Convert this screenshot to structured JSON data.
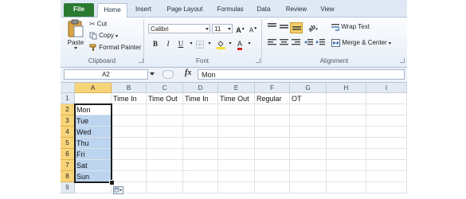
{
  "tabs": [
    "File",
    "Home",
    "Insert",
    "Page Layout",
    "Formulas",
    "Data",
    "Review",
    "View"
  ],
  "clipboard": {
    "paste": "Paste",
    "cut": "Cut",
    "copy": "Copy",
    "format_painter": "Format Painter",
    "group": "Clipboard"
  },
  "font": {
    "name": "Calibri",
    "size": "11",
    "bold": "B",
    "italic": "I",
    "underline": "U",
    "grow": "A",
    "shrink": "A",
    "color_letter": "A",
    "group": "Font"
  },
  "alignment": {
    "wrap_text": "Wrap Text",
    "merge_center": "Merge & Center",
    "group": "Alignment"
  },
  "formula_bar": {
    "name_box": "A2",
    "fx": "fx",
    "content": "Mon"
  },
  "columns": [
    "A",
    "B",
    "C",
    "D",
    "E",
    "F",
    "G",
    "H",
    "I"
  ],
  "rows": [
    "1",
    "2",
    "3",
    "4",
    "5",
    "6",
    "7",
    "8",
    "9"
  ],
  "row1": [
    "",
    "Time In",
    "Time Out",
    "Time In",
    "Time Out",
    "Regular",
    "OT",
    "",
    ""
  ],
  "colA": [
    "",
    "Mon",
    "Tue",
    "Wed",
    "Thu",
    "Fri",
    "Sat",
    "Sun",
    ""
  ],
  "colors": {
    "file_tab": "#2a7a32",
    "selection_fill": "#bcd4ee",
    "selected_header": "#f7d47a"
  }
}
